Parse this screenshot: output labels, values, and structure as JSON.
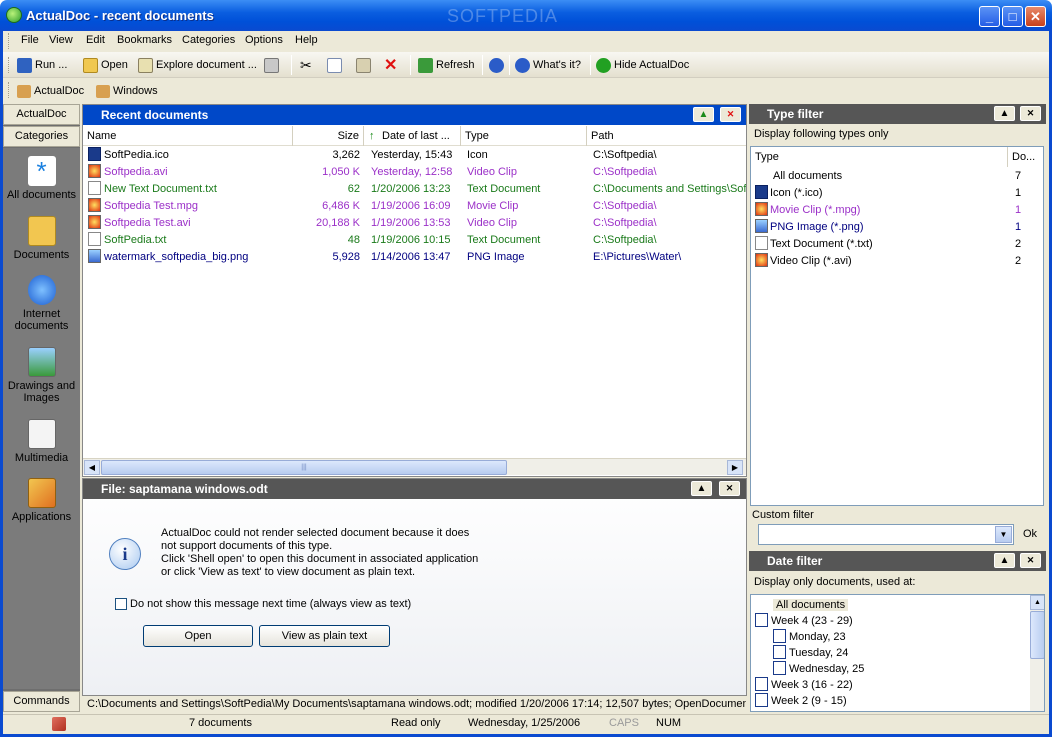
{
  "window": {
    "title": "ActualDoc - recent documents",
    "watermark": "SOFTPEDIA"
  },
  "menu": [
    "File",
    "View",
    "Edit",
    "Bookmarks",
    "Categories",
    "Options",
    "Help"
  ],
  "toolbar": {
    "run": "Run ...",
    "open": "Open",
    "explore": "Explore document ...",
    "refresh": "Refresh",
    "whatsit": "What's it?",
    "hide": "Hide ActualDoc"
  },
  "bookmarks": [
    "ActualDoc",
    "Windows"
  ],
  "sidebar": {
    "tab_actualdoc": "ActualDoc",
    "tab_categories": "Categories",
    "tab_commands": "Commands",
    "categories": [
      {
        "label": "All documents",
        "icon": "asterisk-icon"
      },
      {
        "label": "Documents",
        "icon": "folder-icon"
      },
      {
        "label": "Internet documents",
        "icon": "internet-icon"
      },
      {
        "label": "Drawings and Images",
        "icon": "image-icon"
      },
      {
        "label": "Multimedia",
        "icon": "multimedia-icon"
      },
      {
        "label": "Applications",
        "icon": "applications-icon"
      }
    ]
  },
  "recent": {
    "title": "Recent documents",
    "columns": {
      "name": "Name",
      "size": "Size",
      "date": "Date of last ...",
      "type": "Type",
      "path": "Path"
    },
    "rows": [
      {
        "name": "SoftPedia.ico",
        "size": "3,262",
        "date": "Yesterday, 15:43",
        "type": "Icon",
        "path": "C:\\Softpedia\\",
        "color": "#000000",
        "icon": "ico-icon"
      },
      {
        "name": "Softpedia.avi",
        "size": "1,050 K",
        "date": "Yesterday, 12:58",
        "type": "Video Clip",
        "path": "C:\\Softpedia\\",
        "color": "#9b30c8",
        "icon": "video-icon"
      },
      {
        "name": "New Text Document.txt",
        "size": "62",
        "date": "1/20/2006 13:23",
        "type": "Text Document",
        "path": "C:\\Documents and Settings\\Sof",
        "color": "#1a7a1a",
        "icon": "text-icon"
      },
      {
        "name": "Softpedia Test.mpg",
        "size": "6,486 K",
        "date": "1/19/2006 16:09",
        "type": "Movie Clip",
        "path": "C:\\Softpedia\\",
        "color": "#9b30c8",
        "icon": "movie-icon"
      },
      {
        "name": "Softpedia Test.avi",
        "size": "20,188 K",
        "date": "1/19/2006 13:53",
        "type": "Video Clip",
        "path": "C:\\Softpedia\\",
        "color": "#9b30c8",
        "icon": "video-icon"
      },
      {
        "name": "SoftPedia.txt",
        "size": "48",
        "date": "1/19/2006 10:15",
        "type": "Text Document",
        "path": "C:\\Softpedia\\",
        "color": "#1a7a1a",
        "icon": "text-icon"
      },
      {
        "name": "watermark_softpedia_big.png",
        "size": "5,928",
        "date": "1/14/2006 13:47",
        "type": "PNG Image",
        "path": "E:\\Pictures\\Water\\",
        "color": "#000080",
        "icon": "png-icon"
      }
    ]
  },
  "file_panel": {
    "title": "File: saptamana windows.odt",
    "message": [
      "ActualDoc could not render selected document because it does",
      "not support documents of this type.",
      "Click 'Shell open' to open this document in associated application",
      "or click 'View as text' to view document as plain text."
    ],
    "checkbox": "Do not show this message next time (always view as text)",
    "open_btn": "Open",
    "plain_btn": "View as plain text"
  },
  "type_filter": {
    "title": "Type filter",
    "subtitle": "Display following types only",
    "col_type": "Type",
    "col_docs": "Do...",
    "rows": [
      {
        "label": "All documents",
        "count": "7",
        "color": "#000000",
        "icon": ""
      },
      {
        "label": "Icon (*.ico)",
        "count": "1",
        "color": "#000000",
        "icon": "ico-icon"
      },
      {
        "label": "Movie Clip (*.mpg)",
        "count": "1",
        "color": "#9b30c8",
        "icon": "movie-icon"
      },
      {
        "label": "PNG Image (*.png)",
        "count": "1",
        "color": "#000080",
        "icon": "png-icon"
      },
      {
        "label": "Text Document (*.txt)",
        "count": "2",
        "color": "#000000",
        "icon": "text-icon"
      },
      {
        "label": "Video Clip (*.avi)",
        "count": "2",
        "color": "#000000",
        "icon": "video-icon"
      }
    ],
    "custom_label": "Custom filter",
    "ok": "Ok"
  },
  "date_filter": {
    "title": "Date filter",
    "subtitle": "Display only documents, used at:",
    "items": [
      {
        "label": "All documents",
        "indent": 0,
        "icon": false
      },
      {
        "label": "Week 4 (23 - 29)",
        "indent": 0,
        "icon": true
      },
      {
        "label": "Monday, 23",
        "indent": 1,
        "icon": true
      },
      {
        "label": "Tuesday, 24",
        "indent": 1,
        "icon": true
      },
      {
        "label": "Wednesday, 25",
        "indent": 1,
        "icon": true
      },
      {
        "label": "Week 3 (16 - 22)",
        "indent": 0,
        "icon": true
      },
      {
        "label": "Week 2 (9 - 15)",
        "indent": 0,
        "icon": true
      }
    ]
  },
  "pathbar": "C:\\Documents and Settings\\SoftPedia\\My Documents\\saptamana windows.odt; modified 1/20/2006 17:14; 12,507  bytes; OpenDocumen",
  "statusbar": {
    "count": "7 documents",
    "mode": "Read only",
    "date": "Wednesday, 1/25/2006",
    "caps": "CAPS",
    "num": "NUM"
  }
}
